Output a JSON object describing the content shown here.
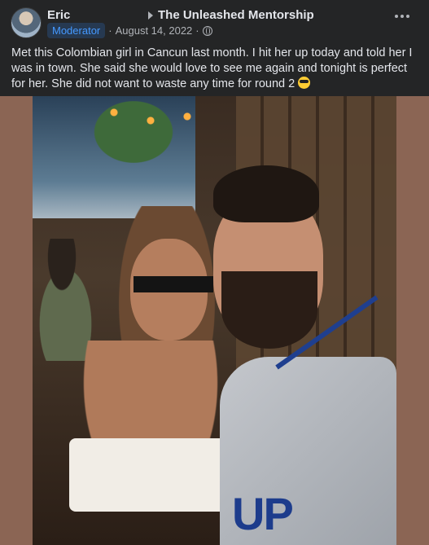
{
  "post": {
    "author": "Eric",
    "group": "The Unleashed Mentorship",
    "role_badge": "Moderator",
    "separator": "·",
    "date": "August 14, 2022",
    "separator2": "·",
    "text": "Met this Colombian girl in Cancun last month. I hit her up today and told her I was in town. She said she would love to see me again and tonight is perfect for her. She did not want to waste any time for round 2",
    "emoji_name": "sunglasses-emoji",
    "photo_jersey_text": "UP"
  },
  "icons": {
    "arrow": "arrow-right-icon",
    "privacy": "globe-icon",
    "more": "more-options-icon"
  },
  "colors": {
    "background": "#242526",
    "badge_text": "#4599ff",
    "badge_bg": "#263951",
    "photo_border": "#8b6554"
  }
}
